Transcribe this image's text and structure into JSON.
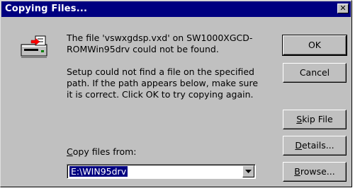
{
  "window": {
    "title": "Copying Files...",
    "close_glyph": "✕"
  },
  "message": {
    "line1": "The file 'vswxgdsp.vxd' on SW1000XGCD-ROMWin95drv could not be found.",
    "line2": "Setup could not find a file on the specified path. If the path appears below, make sure it is correct. Click OK to try copying again."
  },
  "buttons": {
    "ok": "OK",
    "cancel": "Cancel",
    "skip_file_rest": "kip File",
    "skip_file_mnemonic": "S",
    "details_rest": "etails...",
    "details_mnemonic": "D",
    "browse_rest": "rowse...",
    "browse_mnemonic": "B"
  },
  "copy_from": {
    "label_mnemonic": "C",
    "label_rest": "opy files from:",
    "value": "E:\\WIN95drv"
  },
  "icons": {
    "dialog": "disk-drive-icon",
    "dropdown": "chevron-down-icon"
  }
}
